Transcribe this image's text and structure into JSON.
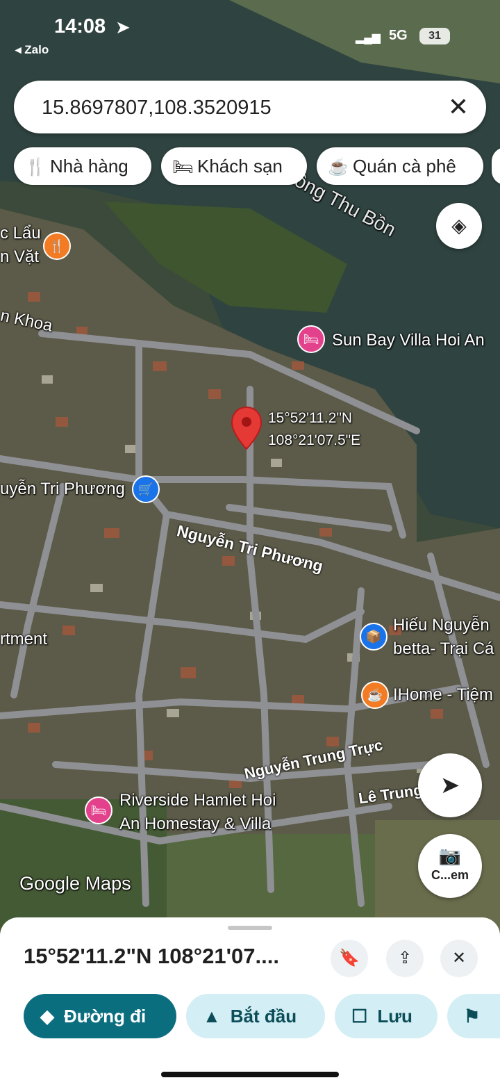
{
  "status_bar": {
    "time": "14:08",
    "back_app": "Zalo",
    "network": "5G",
    "battery": "31"
  },
  "search": {
    "value": "15.8697807,108.3520915",
    "clear_icon": "close-icon"
  },
  "chips": [
    {
      "icon": "fork-knife-icon",
      "label": "Nhà hàng"
    },
    {
      "icon": "bed-icon",
      "label": "Khách sạn"
    },
    {
      "icon": "coffee-cup-icon",
      "label": "Quán cà phê"
    }
  ],
  "map": {
    "river_label": "sông Thu Bồn",
    "pin_coords_line1": "15°52'11.2\"N",
    "pin_coords_line2": "108°21'07.5\"E",
    "places": {
      "lau": "c Lẩu",
      "lau2": "n Vặt",
      "khoa": "n Khoa",
      "sunbay": "Sun Bay Villa Hoi An",
      "shop": "uyễn Tri Phương",
      "apartment": "rtment",
      "hieu1": "Hiếu Nguyễn",
      "hieu2": "betta- Trại Cá",
      "ihome": "IHome - Tiệm",
      "riverside1": "Riverside Hamlet Hoi",
      "riverside2": "An Homestay & Villa"
    },
    "roads": {
      "ntp": "Nguyễn Tri Phương",
      "ntt": "Nguyễn Trung Trực",
      "lt": "Lê Trung"
    },
    "watermark": "Google Maps",
    "camera_label": "C...em"
  },
  "sheet": {
    "title": "15°52'11.2\"N 108°21'07....",
    "actions": [
      {
        "icon": "directions-icon",
        "label": "Đường đi"
      },
      {
        "icon": "navigation-arrow-icon",
        "label": "Bắt đầu"
      },
      {
        "icon": "bookmark-icon",
        "label": "Lưu"
      },
      {
        "icon": "flag-icon",
        "label": ""
      }
    ]
  },
  "colors": {
    "primary_button": "#0b6e7f",
    "secondary_button": "#d3eef4",
    "pin": "#e53935",
    "hotel_poi": "#e3418c",
    "food_poi": "#f27b23",
    "shop_poi": "#1a73e8"
  }
}
